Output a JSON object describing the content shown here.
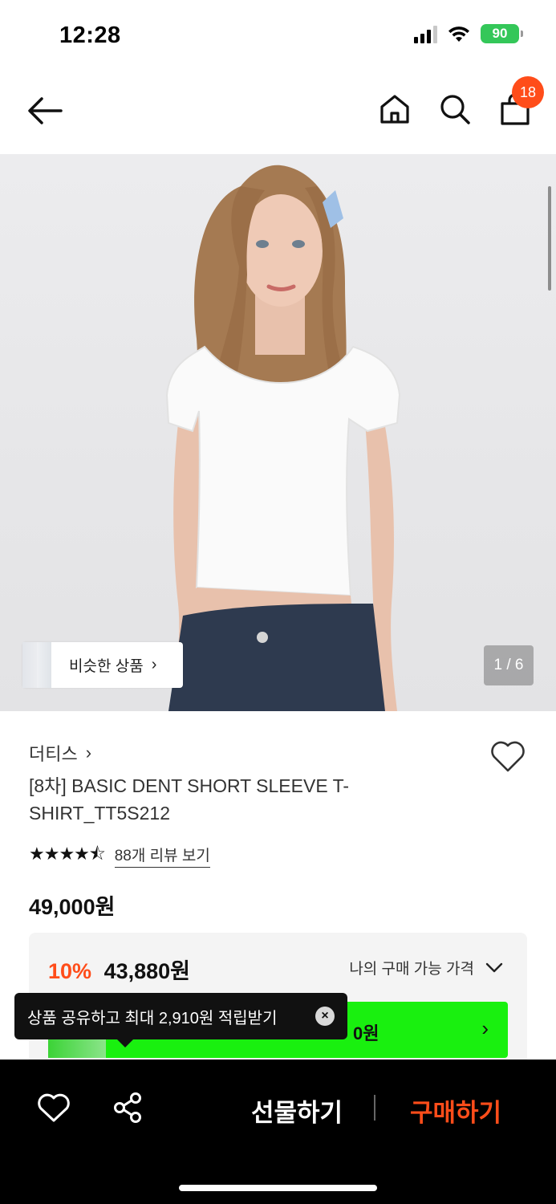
{
  "status": {
    "time": "12:28",
    "battery": "90"
  },
  "nav": {
    "cart_count": "18"
  },
  "product_image": {
    "similar_label": "비슷한 상품",
    "counter": "1 / 6"
  },
  "product": {
    "brand": "더티스",
    "name": "[8차] BASIC DENT SHORT SLEEVE T-SHIRT_TT5S212",
    "rating": 4.5,
    "review_link": "88개 리뷰 보기",
    "price": "49,000원"
  },
  "benefit": {
    "discount_rate": "10%",
    "discount_price": "43,880원",
    "my_price_label": "나의 구매 가능 가격",
    "green_bar_text": "0원"
  },
  "toast": {
    "message": "상품 공유하고 최대 2,910원 적립받기"
  },
  "bottom_bar": {
    "gift_label": "선물하기",
    "buy_label": "구매하기"
  },
  "colors": {
    "accent": "#ff4d1a",
    "green": "#19f00f",
    "battery": "#34c759"
  }
}
